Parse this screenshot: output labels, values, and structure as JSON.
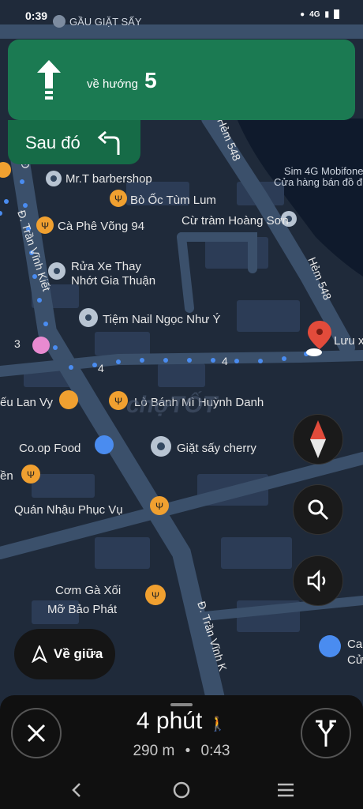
{
  "status": {
    "time": "0:39",
    "network": "4G"
  },
  "navigation": {
    "direction_text": "về hướng",
    "road_number": "5",
    "then_label": "Sau đó"
  },
  "map": {
    "poi": [
      {
        "name": "GẦU GIẶT SẤY"
      },
      {
        "name": "Mr.T barbershop"
      },
      {
        "name": "Bò Ốc Tùm Lum"
      },
      {
        "name": "Cà Phê Võng 94"
      },
      {
        "name": "Cừ tràm Hoàng Sơn"
      },
      {
        "name": "Sim 4G Mobifone"
      },
      {
        "name": "Cửa hàng bán đồ điện tử"
      },
      {
        "name": "Rửa Xe Thay"
      },
      {
        "name": "Nhớt Gia Thuận"
      },
      {
        "name": "Tiệm Nail Ngọc Như Ý"
      },
      {
        "name": "Lưu x"
      },
      {
        "name": "ếu Lan Vy"
      },
      {
        "name": "Lò Bánh Mì Huỳnh Danh"
      },
      {
        "name": "Co.op Food"
      },
      {
        "name": "Giặt sấy cherry"
      },
      {
        "name": "ền"
      },
      {
        "name": "Quán Nhậu Phục Vụ"
      },
      {
        "name": "Cơm Gà Xối"
      },
      {
        "name": "Mỡ Bảo Phát"
      },
      {
        "name": "Ca"
      },
      {
        "name": "Cử"
      }
    ],
    "roads": [
      {
        "name": "Đ. Trần Vĩnh Kiết"
      },
      {
        "name": "Hẻm 548"
      },
      {
        "name": "Hẻm 548"
      },
      {
        "name": "Đ. Trần Vĩnh K"
      },
      {
        "name": "4"
      },
      {
        "name": "4"
      },
      {
        "name": "3"
      },
      {
        "name": "Đ"
      }
    ],
    "watermark": "chợTỐT"
  },
  "controls": {
    "recenter_label": "Về giữa",
    "compass_icon": "compass-icon",
    "search_icon": "search-icon",
    "sound_icon": "sound-icon"
  },
  "trip": {
    "eta": "4 phút",
    "distance": "290 m",
    "arrival": "0:43",
    "separator": "•"
  },
  "colors": {
    "nav_green": "#1b7a52",
    "route_blue": "#4a8cf0",
    "pin_red": "#e24b3b",
    "food_orange": "#f0a030",
    "map_bg": "#1e2836"
  }
}
